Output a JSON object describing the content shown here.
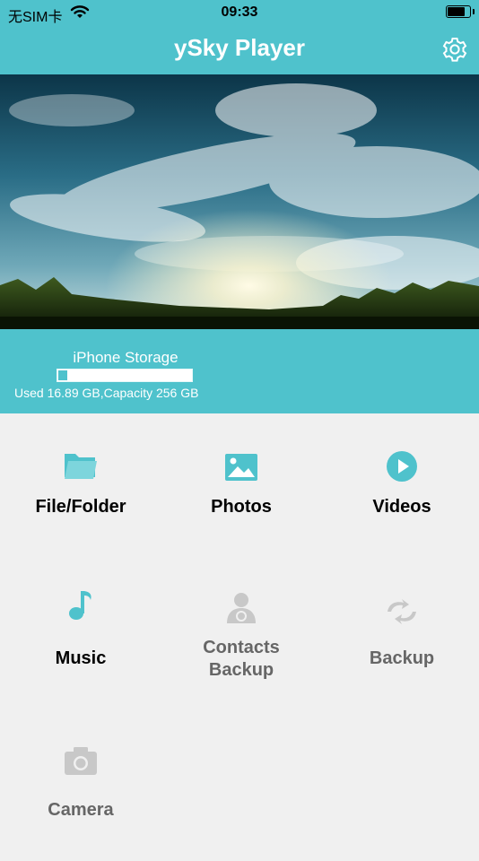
{
  "status_bar": {
    "carrier": "无SIM卡",
    "time": "09:33",
    "battery_level": 0.78
  },
  "navbar": {
    "title": "ySky Player",
    "settings_icon": "gear-icon"
  },
  "banner": {
    "icon": "sky-landscape-image"
  },
  "storage": {
    "title": "iPhone Storage",
    "used_fraction": 0.066,
    "usage_text": "Used 16.89 GB,Capacity 256 GB"
  },
  "grid": {
    "tiles": [
      {
        "label": "File/Folder",
        "icon": "folder-icon",
        "enabled": true
      },
      {
        "label": "Photos",
        "icon": "photo-icon",
        "enabled": true
      },
      {
        "label": "Videos",
        "icon": "play-icon",
        "enabled": true
      },
      {
        "label": "Music",
        "icon": "music-note-icon",
        "enabled": true
      },
      {
        "label": "Contacts Backup",
        "icon": "contact-icon",
        "enabled": false
      },
      {
        "label": "Backup",
        "icon": "sync-icon",
        "enabled": false
      },
      {
        "label": "Camera",
        "icon": "camera-icon",
        "enabled": false
      }
    ]
  },
  "colors": {
    "accent": "#4fc2cc",
    "disabled": "#c8c8c8",
    "background": "#f0f0f0"
  }
}
